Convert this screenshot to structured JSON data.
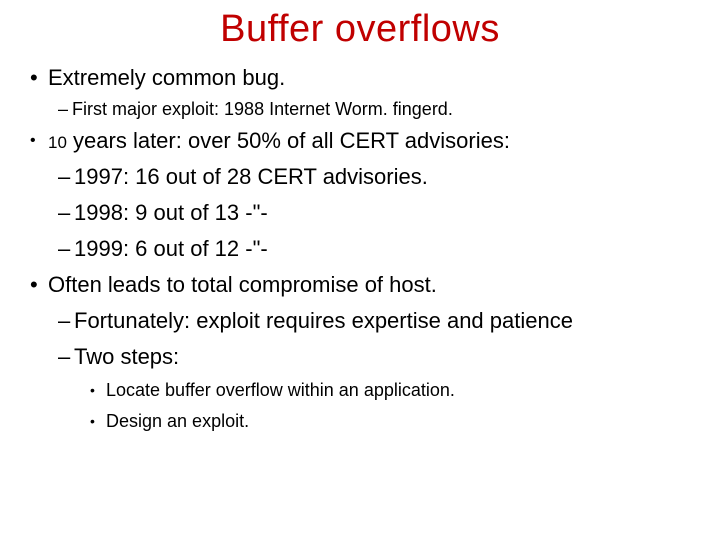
{
  "title": "Buffer overflows",
  "b1": "Extremely common bug.",
  "b1_sub": "First major exploit:  1988 Internet Worm.   fingerd.",
  "b2_num": "10",
  "b2_rest": " years later:     over 50% of all CERT advisories:",
  "b2_sub1": "1997:  16 out of 28    CERT advisories.",
  "b2_sub2": "1998:   9 out of 13              -\"-",
  "b2_sub3": "1999:   6 out of 12              -\"-",
  "b3": "Often leads to total compromise of host.",
  "b3_sub1": "Fortunately:  exploit requires expertise and patience",
  "b3_sub2": "Two steps:",
  "b3_sub2a": "Locate buffer overflow within an application.",
  "b3_sub2b": "Design an exploit."
}
